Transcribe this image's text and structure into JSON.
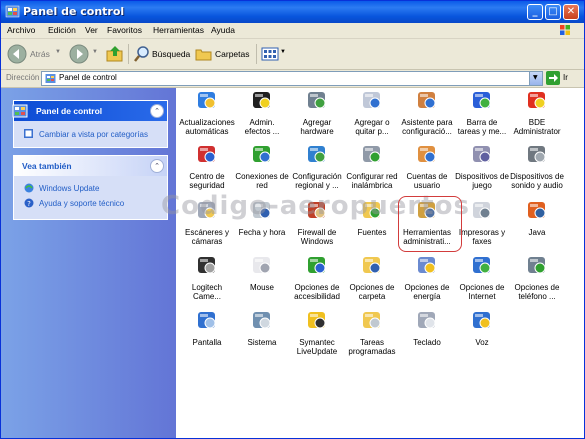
{
  "window": {
    "title": "Panel de control"
  },
  "menu": [
    "Archivo",
    "Edición",
    "Ver",
    "Favoritos",
    "Herramientas",
    "Ayuda"
  ],
  "toolbar": {
    "back": "Atrás",
    "search": "Búsqueda",
    "folders": "Carpetas"
  },
  "address": {
    "label": "Dirección",
    "value": "Panel de control",
    "go": "Ir"
  },
  "left": {
    "panel1_title": "Panel de control",
    "panel1_link": "Cambiar a vista por categorías",
    "panel2_title": "Vea también",
    "panel2_links": [
      "Windows Update",
      "Ayuda y soporte técnico"
    ]
  },
  "items": [
    {
      "l1": "Actualizaciones",
      "l2": "automáticas",
      "icon": "globe-shield-icon"
    },
    {
      "l1": "Admin.",
      "l2": "efectos ...",
      "icon": "speaker-icon"
    },
    {
      "l1": "Agregar",
      "l2": "hardware",
      "icon": "hardware-icon"
    },
    {
      "l1": "Agregar o",
      "l2": "quitar p...",
      "icon": "cd-box-icon"
    },
    {
      "l1": "Asistente para",
      "l2": "configuració...",
      "icon": "house-icon"
    },
    {
      "l1": "Barra de",
      "l2": "tareas y me...",
      "icon": "taskbar-icon"
    },
    {
      "l1": "BDE",
      "l2": "Administrator",
      "icon": "bde-icon"
    },
    {
      "l1": "Centro de",
      "l2": "seguridad",
      "icon": "shield-icon"
    },
    {
      "l1": "Conexiones de",
      "l2": "red",
      "icon": "network-icon"
    },
    {
      "l1": "Configuración",
      "l2": "regional y ...",
      "icon": "globe-icon"
    },
    {
      "l1": "Configurar red",
      "l2": "inalámbrica",
      "icon": "wireless-icon"
    },
    {
      "l1": "Cuentas de",
      "l2": "usuario",
      "icon": "users-icon"
    },
    {
      "l1": "Dispositivos de",
      "l2": "juego",
      "icon": "gamepad-icon"
    },
    {
      "l1": "Dispositivos de",
      "l2": "sonido y audio",
      "icon": "audio-icon"
    },
    {
      "l1": "Escáneres y",
      "l2": "cámaras",
      "icon": "scanner-icon"
    },
    {
      "l1": "Fecha y hora",
      "l2": "",
      "icon": "clock-icon"
    },
    {
      "l1": "Firewall de",
      "l2": "Windows",
      "icon": "firewall-icon"
    },
    {
      "l1": "Fuentes",
      "l2": "",
      "icon": "fonts-folder-icon"
    },
    {
      "l1": "Herramientas",
      "l2": "administrati...",
      "icon": "admin-tools-icon"
    },
    {
      "l1": "Impresoras y",
      "l2": "faxes",
      "icon": "printer-icon"
    },
    {
      "l1": "Java",
      "l2": "",
      "icon": "java-icon"
    },
    {
      "l1": "Logitech",
      "l2": "Came...",
      "icon": "logitech-icon"
    },
    {
      "l1": "Mouse",
      "l2": "",
      "icon": "mouse-icon"
    },
    {
      "l1": "Opciones de",
      "l2": "accesibilidad",
      "icon": "accessibility-icon"
    },
    {
      "l1": "Opciones de",
      "l2": "carpeta",
      "icon": "folder-options-icon"
    },
    {
      "l1": "Opciones de",
      "l2": "energía",
      "icon": "power-icon"
    },
    {
      "l1": "Opciones de",
      "l2": "Internet",
      "icon": "internet-icon"
    },
    {
      "l1": "Opciones de",
      "l2": "teléfono ...",
      "icon": "phone-icon"
    },
    {
      "l1": "Pantalla",
      "l2": "",
      "icon": "display-icon"
    },
    {
      "l1": "Sistema",
      "l2": "",
      "icon": "system-icon"
    },
    {
      "l1": "Symantec",
      "l2": "LiveUpdate",
      "icon": "liveupdate-icon"
    },
    {
      "l1": "Tareas",
      "l2": "programadas",
      "icon": "tasks-folder-icon"
    },
    {
      "l1": "Teclado",
      "l2": "",
      "icon": "keyboard-icon"
    },
    {
      "l1": "Voz",
      "l2": "",
      "icon": "voice-icon"
    }
  ],
  "watermark": "Codigo-aeropuertos"
}
